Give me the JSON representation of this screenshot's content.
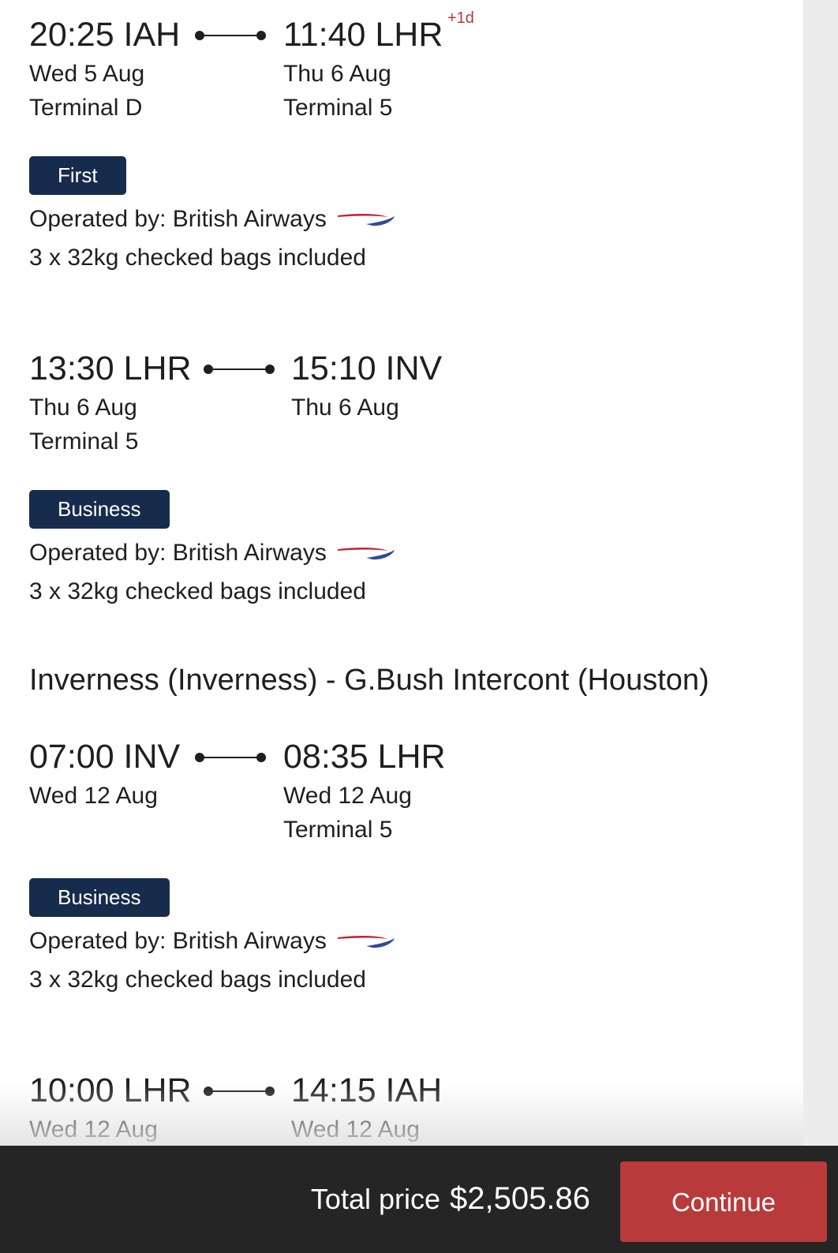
{
  "segments": [
    {
      "dep_time": "20:25 IAH",
      "dep_date": "Wed 5 Aug",
      "dep_terminal": "Terminal D",
      "arr_time": "11:40 LHR",
      "arr_dayplus": "+1d",
      "arr_date": "Thu 6 Aug",
      "arr_terminal": "Terminal 5",
      "cabin": "First",
      "operated": "Operated by: British Airways",
      "bags": "3 x 32kg checked bags included"
    },
    {
      "dep_time": "13:30 LHR",
      "dep_date": "Thu 6 Aug",
      "dep_terminal": "Terminal 5",
      "arr_time": "15:10 INV",
      "arr_date": "Thu 6 Aug",
      "cabin": "Business",
      "operated": "Operated by: British Airways",
      "bags": "3 x 32kg checked bags included"
    },
    {
      "dep_time": "07:00 INV",
      "dep_date": "Wed 12 Aug",
      "arr_time": "08:35 LHR",
      "arr_date": "Wed 12 Aug",
      "arr_terminal": "Terminal 5",
      "cabin": "Business",
      "operated": "Operated by: British Airways",
      "bags": "3 x 32kg checked bags included"
    },
    {
      "dep_time": "10:00 LHR",
      "dep_date": "Wed 12 Aug",
      "arr_time": "14:15 IAH",
      "arr_date": "Wed 12 Aug"
    }
  ],
  "return_route": "Inverness (Inverness) - G.Bush Intercont (Houston)",
  "footer": {
    "total_label": "Total price",
    "total_value": "$2,505.86",
    "continue_label": "Continue"
  },
  "colors": {
    "badge": "#172b4d",
    "accent_red": "#b83a3a",
    "footer_bg": "#252525"
  },
  "icons": {
    "airline_logo": "british-airways-speedmarque-icon",
    "route_connector": "flight-connector-icon"
  }
}
